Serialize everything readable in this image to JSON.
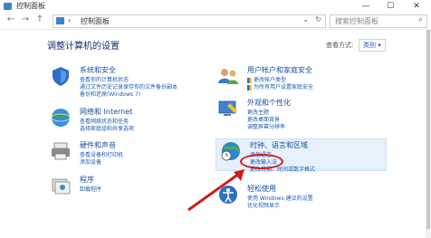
{
  "window": {
    "title": "控制面板",
    "minimize": "—",
    "maximize": "☐",
    "close": "✕"
  },
  "nav": {
    "back": "←",
    "forward": "→",
    "up": "↑"
  },
  "address": {
    "crumb_sep": "›",
    "crumb_label": "控制面板",
    "dropdown": "⌄",
    "refresh": "↻"
  },
  "search": {
    "placeholder": "搜索控制面板",
    "icon": "search-icon",
    "glyph": "⌕"
  },
  "header": {
    "title": "调整计算机的设置",
    "view_by_label": "查看方式:",
    "view_mode": "类别 ▾"
  },
  "categories_left": [
    {
      "title": "系统和安全",
      "links": [
        "查看你的计算机状态",
        "通过文件历史记录保存你的文件备份副本",
        "备份和还原(Windows 7)"
      ]
    },
    {
      "title": "网络和 Internet",
      "links": [
        "查看网络状态和任务",
        "选择家庭组和共享选项"
      ]
    },
    {
      "title": "硬件和声音",
      "links": [
        "查看设备和打印机",
        "添加设备"
      ]
    },
    {
      "title": "程序",
      "links": [
        "卸载程序"
      ]
    }
  ],
  "categories_right": [
    {
      "title": "用户帐户和家庭安全",
      "links": [
        "更改帐户类型",
        "为所有用户设置家庭安全"
      ]
    },
    {
      "title": "外观和个性化",
      "links": [
        "更改主题",
        "更改桌面背景",
        "调整屏幕分辨率"
      ]
    },
    {
      "title": "时钟、语言和区域",
      "links": [
        "添加语言",
        "更改输入法",
        "更改日期、时间或数字格式"
      ]
    },
    {
      "title": "轻松使用",
      "links": [
        "使用 Windows 建议的设置",
        "优化视频显示"
      ]
    }
  ],
  "colors": {
    "link": "#1a5bb5",
    "title": "#1a4f9c",
    "header": "#1a2e6b",
    "annotation": "#d11b1b"
  }
}
